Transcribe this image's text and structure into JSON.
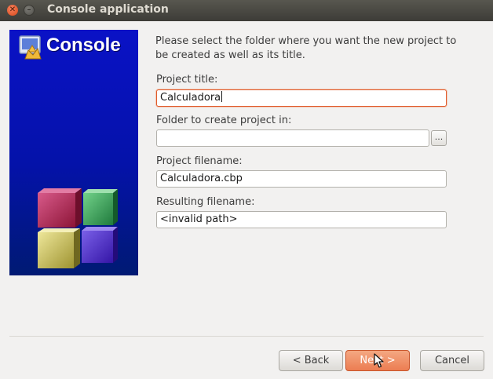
{
  "window": {
    "title": "Console application",
    "close_glyph": "✕",
    "minimize_glyph": "–"
  },
  "banner": {
    "title": "Console",
    "icon": "console-app-icon",
    "background": "#0a12c6"
  },
  "instructions": "Please select the folder where you want the new project to be created as well as its title.",
  "form": {
    "project_title": {
      "label": "Project title:",
      "value": "Calculadora"
    },
    "folder": {
      "label": "Folder to create project in:",
      "value": "",
      "browse_label": "..."
    },
    "project_filename": {
      "label": "Project filename:",
      "value": "Calculadora.cbp"
    },
    "resulting_filename": {
      "label": "Resulting filename:",
      "value": "<invalid path>"
    }
  },
  "buttons": {
    "back": "< Back",
    "next": "Next >",
    "cancel": "Cancel"
  },
  "colors": {
    "accent": "#ec7d52",
    "focus_border": "#e05a2a",
    "titlebar": "#3d3c37"
  }
}
